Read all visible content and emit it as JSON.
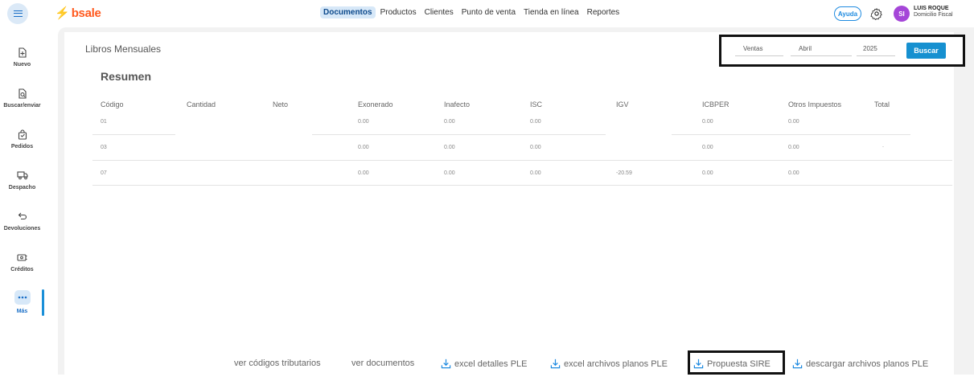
{
  "header": {
    "brand": "bsale",
    "nav": [
      "Documentos",
      "Productos",
      "Clientes",
      "Punto de venta",
      "Tienda en línea",
      "Reportes"
    ],
    "active_nav": "Documentos",
    "help_label": "Ayuda",
    "avatar_initials": "SI",
    "user_name": "LUIS ROQUE",
    "user_sub": "Domicilio Fiscal"
  },
  "sidebar": {
    "items": [
      {
        "label": "Nuevo",
        "icon": "file-plus-icon"
      },
      {
        "label": "Buscar/enviar",
        "icon": "file-search-icon"
      },
      {
        "label": "Pedidos",
        "icon": "bag-icon"
      },
      {
        "label": "Despacho",
        "icon": "truck-icon"
      },
      {
        "label": "Devoluciones",
        "icon": "return-arrow-icon"
      },
      {
        "label": "Créditos",
        "icon": "credit-note-icon"
      },
      {
        "label": "Más",
        "icon": "more-dots-icon"
      }
    ]
  },
  "page": {
    "title": "Libros Mensuales",
    "section": "Resumen"
  },
  "filters": {
    "tipo": "Ventas",
    "mes": "Abril",
    "anio": "2025",
    "buscar_label": "Buscar"
  },
  "table": {
    "headers": [
      "Código",
      "Cantidad",
      "Neto",
      "Exonerado",
      "Inafecto",
      "ISC",
      "IGV",
      "ICBPER",
      "Otros Impuestos",
      "Total"
    ],
    "rows": [
      [
        "01",
        "",
        "",
        "0.00",
        "0.00",
        "0.00",
        "",
        "0.00",
        "0.00",
        ""
      ],
      [
        "03",
        "",
        "",
        "0.00",
        "0.00",
        "0.00",
        "",
        "0.00",
        "0.00",
        "."
      ],
      [
        "07",
        "",
        "",
        "0.00",
        "0.00",
        "0.00",
        "-20.59",
        "0.00",
        "0.00",
        ""
      ]
    ]
  },
  "footer": {
    "links": [
      "ver códigos tributarios",
      "ver documentos",
      "excel detalles PLE",
      "excel archivos planos PLE",
      "Propuesta SIRE",
      "descargar archivos planos PLE"
    ]
  },
  "colors": {
    "brand": "#ff5a1f",
    "primary": "#1690d0",
    "active_nav_bg": "#d7e8f8",
    "avatar": "#a546d8"
  }
}
